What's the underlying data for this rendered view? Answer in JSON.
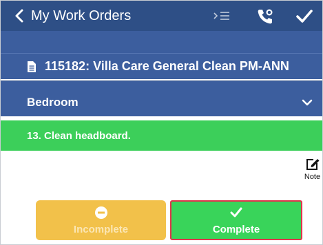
{
  "nav": {
    "back_label": "My Work Orders",
    "icons": [
      "chevron-left-icon",
      "steps-list-icon",
      "phone-icon",
      "checkmark-icon"
    ]
  },
  "work_order": {
    "title": "115182: Villa Care General Clean PM-ANN",
    "icon": "document-icon"
  },
  "section": {
    "label": "Bedroom",
    "icon": "chevron-down-icon"
  },
  "task": {
    "label": "13. Clean headboard."
  },
  "note": {
    "label": "Note",
    "icon": "edit-icon"
  },
  "actions": {
    "incomplete_label": "Incomplete",
    "complete_label": "Complete"
  },
  "colors": {
    "nav_bg": "#2e4f86",
    "header_bg": "#3c5e9e",
    "task_bg": "#3ccf5a",
    "incomplete_bg": "#f2c14a",
    "complete_bg": "#39d45a",
    "highlight_border": "#e0344b"
  }
}
